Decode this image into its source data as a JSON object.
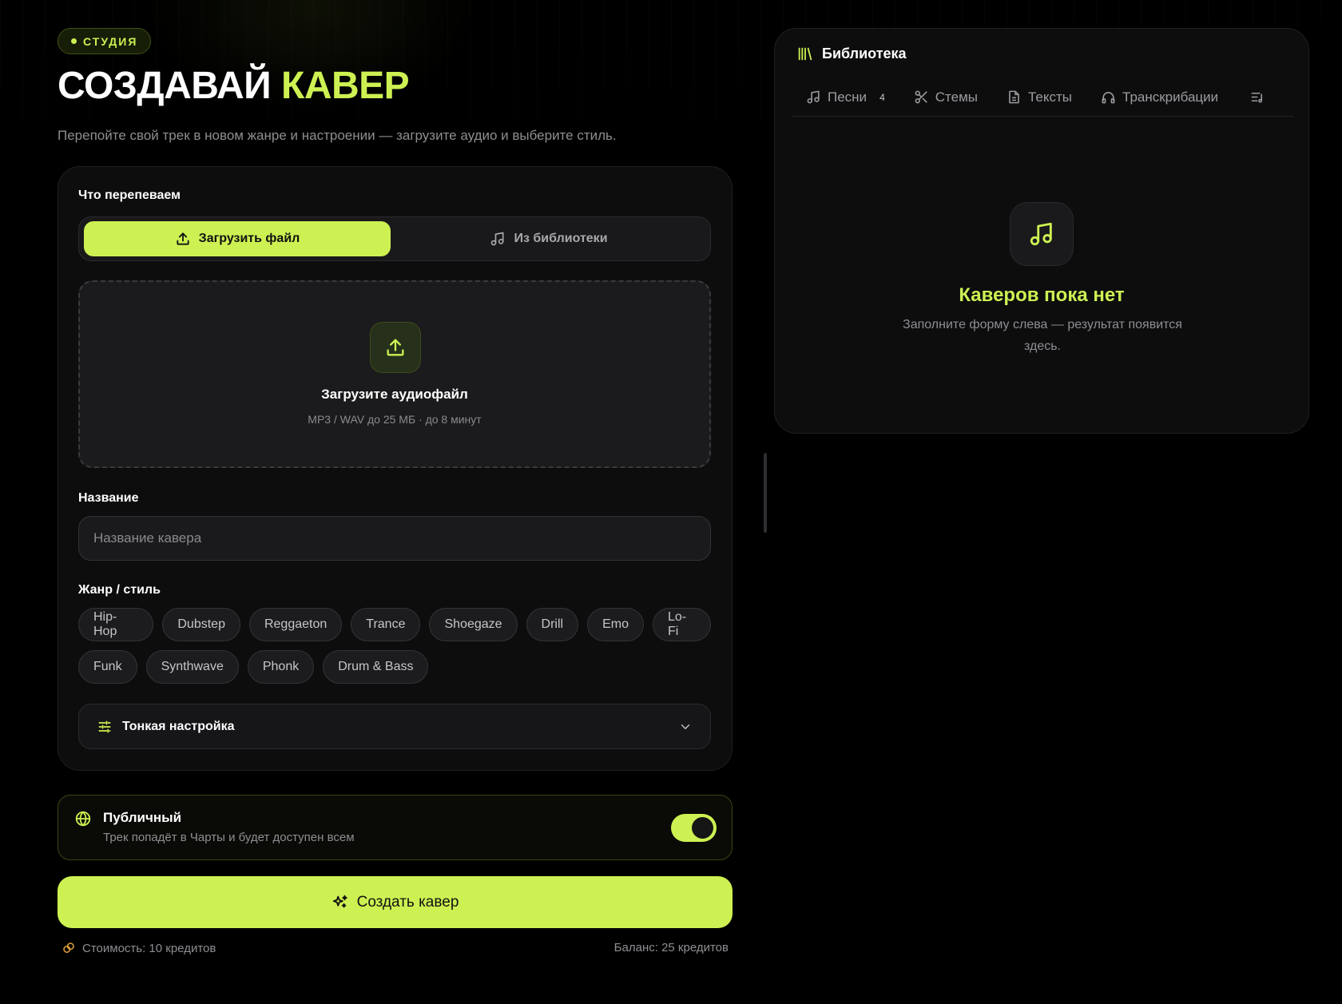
{
  "header": {
    "badge": "СТУДИЯ",
    "title_main": "СОЗДАВАЙ",
    "title_accent": "КАВЕР",
    "subtitle": "Перепойте свой трек в новом жанре и настроении — загрузите аудио и выберите стиль."
  },
  "form": {
    "source_label": "Что перепеваем",
    "source_tabs": {
      "upload": "Загрузить файл",
      "library": "Из библиотеки"
    },
    "dropzone": {
      "title": "Загрузите аудиофайл",
      "hint": "MP3 / WAV до 25 МБ · до 8 минут"
    },
    "name_label": "Название",
    "name_placeholder": "Название кавера",
    "name_value": "",
    "genre_label": "Жанр / стиль",
    "genres": [
      "Hip-Hop",
      "Dubstep",
      "Reggaeton",
      "Trance",
      "Shoegaze",
      "Drill",
      "Emo",
      "Lo-Fi",
      "Funk",
      "Synthwave",
      "Phonk",
      "Drum & Bass"
    ],
    "fine_tuning": "Тонкая настройка"
  },
  "visibility": {
    "title": "Публичный",
    "description": "Трек попадёт в Чарты и будет доступен всем",
    "enabled": true
  },
  "actions": {
    "create": "Создать кавер",
    "cost": "Стоимость: 10 кредитов",
    "balance": "Баланс: 25 кредитов"
  },
  "library": {
    "title": "Библиотека",
    "tabs": [
      {
        "label": "Песни",
        "count": "4",
        "icon": "music-note-icon"
      },
      {
        "label": "Стемы",
        "icon": "scissors-icon"
      },
      {
        "label": "Тексты",
        "icon": "document-icon"
      },
      {
        "label": "Транскрибации",
        "icon": "headphones-icon"
      }
    ],
    "empty_title": "Каверов пока нет",
    "empty_text": "Заполните форму слева — результат появится здесь."
  },
  "colors": {
    "accent": "#cdf152",
    "background": "#000000",
    "card": "#0d0d0e",
    "muted_text": "#8e8e93"
  }
}
